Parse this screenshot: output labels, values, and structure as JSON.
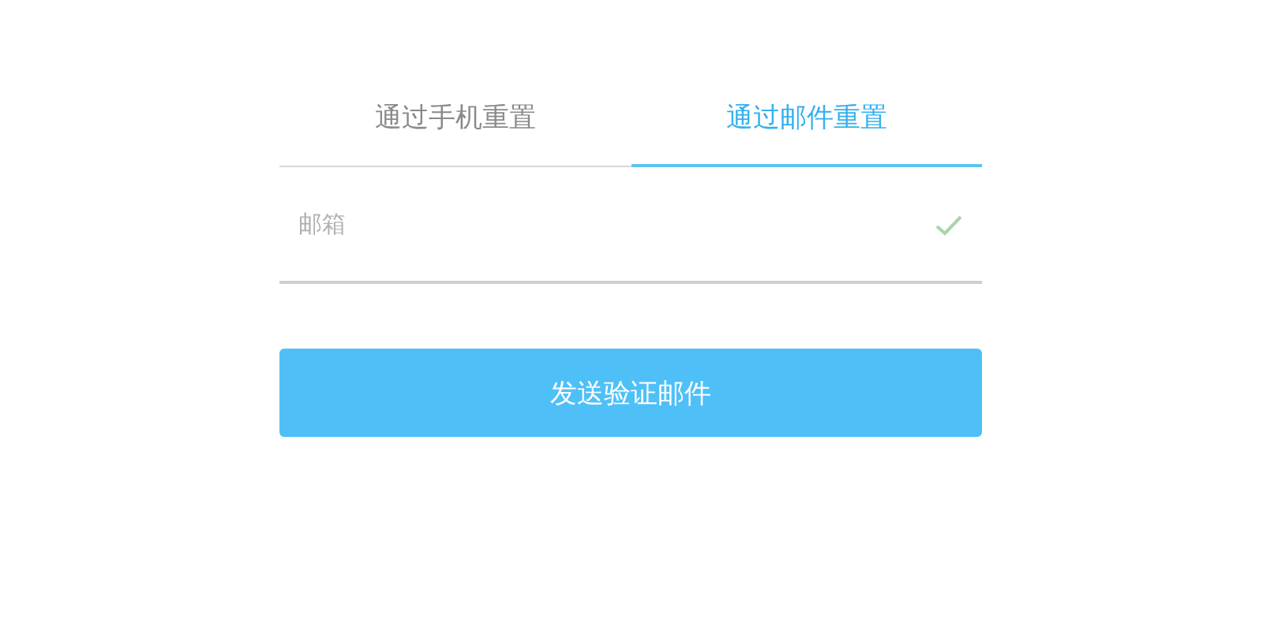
{
  "tabs": [
    {
      "label": "通过手机重置",
      "selected": false
    },
    {
      "label": "通过邮件重置",
      "selected": true
    }
  ],
  "email_field": {
    "placeholder": "邮箱",
    "valid": true
  },
  "submit_button": {
    "label": "发送验证邮件"
  }
}
